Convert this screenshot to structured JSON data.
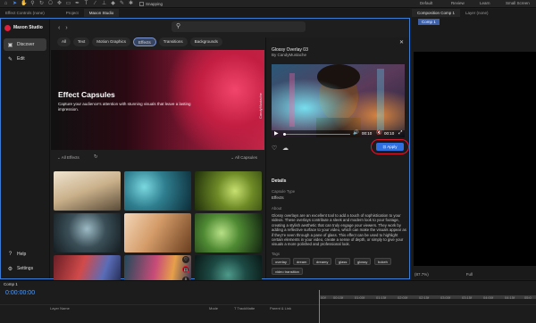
{
  "toolbar": {
    "snapping_label": "Snapping",
    "workspaces": [
      "Default",
      "Review",
      "Learn",
      "Small Screen"
    ]
  },
  "panel_tabs": {
    "effect_controls": "Effect Controls (none)",
    "project": "Project",
    "maxon_studio": "Maxon Studio"
  },
  "sidebar": {
    "brand": "Maxon Studio",
    "items": [
      {
        "icon": "discover-icon",
        "label": "Discover"
      },
      {
        "icon": "edit-icon",
        "label": "Edit"
      }
    ],
    "bottom": [
      {
        "icon": "help-icon",
        "label": "Help"
      },
      {
        "icon": "settings-icon",
        "label": "Settings"
      }
    ]
  },
  "categories": [
    "All",
    "Text",
    "Motion Graphics",
    "Effects",
    "Transitions",
    "Backgrounds"
  ],
  "active_category": "Effects",
  "hero": {
    "title": "Effect Capsules",
    "subtitle": "Capture your audience's attention with stunning visuals that leave a lasting impression.",
    "credit": "CandyMustache"
  },
  "filters": {
    "left": "All Effects",
    "right": "All Capsules"
  },
  "detail": {
    "title": "Glossy Overlay 03",
    "author": "By CandyMustache",
    "time_current": "00:10",
    "time_total": "00:10",
    "apply_label": "Apply",
    "details_heading": "Details",
    "capsule_type_label": "Capsule Type",
    "capsule_type_value": "Effects",
    "about_label": "About",
    "about_text": "Glossy overlays are an excellent tool to add a touch of sophistication to your videos. These overlays contribute a sleek and modern look to your footage, creating a stylish aesthetic that can truly engage your viewers. They work by adding a reflective surface to your video, which can make the visuals appear as if they're seen through a pane of glass. This effect can be used to highlight certain elements in your video, create a sense of depth, or simply to give your visuals a more polished and professional look.",
    "tags_label": "Tags",
    "tags": [
      "overlay",
      "dream",
      "dreamy",
      "glass",
      "glossy",
      "bokeh",
      "video transition"
    ]
  },
  "composition": {
    "tab": "Composition Comp 1",
    "layer_tab": "Layer (none)",
    "chip": "Comp 1",
    "zoom": "(87.7%)",
    "quality": "Full"
  },
  "timeline": {
    "tab": "Comp 1",
    "time": "0:00:00:00",
    "ticks": [
      "00f",
      "00:15f",
      "01:00f",
      "01:15f",
      "02:00f",
      "02:15f",
      "03:00f",
      "03:15f",
      "04:00f",
      "04:15f",
      "05:0"
    ],
    "columns": {
      "layer_name": "Layer Name",
      "mode": "Mode",
      "trackmatte": "T TrackMatte",
      "parent": "Parent & Link"
    }
  },
  "colors": {
    "accent_blue": "#2f6fe0",
    "brand_red": "#e01f3d",
    "highlight_ring": "#e01830"
  }
}
